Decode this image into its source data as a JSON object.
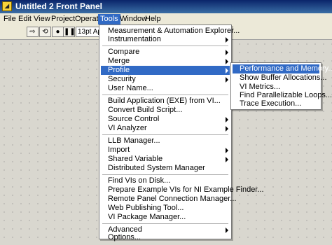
{
  "window": {
    "title": "Untitled 2 Front Panel"
  },
  "menubar": {
    "items": [
      {
        "label": "File"
      },
      {
        "label": "Edit"
      },
      {
        "label": "View"
      },
      {
        "label": "Project"
      },
      {
        "label": "Operate"
      },
      {
        "label": "Tools",
        "active": true
      },
      {
        "label": "Window"
      },
      {
        "label": "Help"
      }
    ]
  },
  "toolbar": {
    "font_value": "13pt Ap"
  },
  "tools_menu": {
    "items": [
      {
        "label": "Measurement & Automation Explorer..."
      },
      {
        "label": "Instrumentation",
        "submenu": true
      },
      {
        "label": "Compare",
        "submenu": true
      },
      {
        "label": "Merge",
        "submenu": true
      },
      {
        "label": "Profile",
        "submenu": true,
        "highlighted": true
      },
      {
        "label": "Security",
        "submenu": true
      },
      {
        "label": "User Name..."
      },
      {
        "label": "Build Application (EXE) from VI..."
      },
      {
        "label": "Convert Build Script..."
      },
      {
        "label": "Source Control",
        "submenu": true
      },
      {
        "label": "VI Analyzer",
        "submenu": true
      },
      {
        "label": "LLB Manager..."
      },
      {
        "label": "Import",
        "submenu": true
      },
      {
        "label": "Shared Variable",
        "submenu": true
      },
      {
        "label": "Distributed System Manager"
      },
      {
        "label": "Find VIs on Disk..."
      },
      {
        "label": "Prepare Example VIs for NI Example Finder..."
      },
      {
        "label": "Remote Panel Connection Manager..."
      },
      {
        "label": "Web Publishing Tool..."
      },
      {
        "label": "VI Package Manager..."
      },
      {
        "label": "Advanced",
        "submenu": true
      },
      {
        "label": "Options..."
      }
    ]
  },
  "profile_submenu": {
    "items": [
      {
        "label": "Performance and Memory...",
        "highlighted": true
      },
      {
        "label": "Show Buffer Allocations..."
      },
      {
        "label": "VI Metrics..."
      },
      {
        "label": "Find Parallelizable Loops..."
      },
      {
        "label": "Trace Execution..."
      }
    ]
  }
}
